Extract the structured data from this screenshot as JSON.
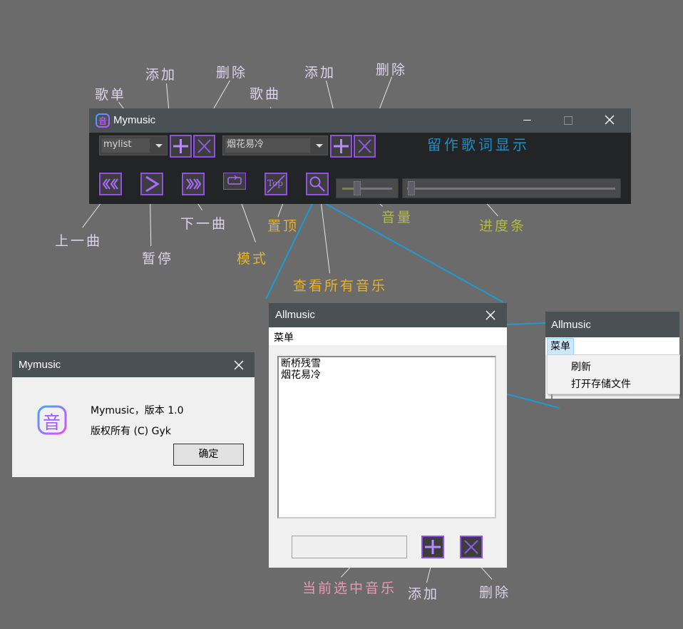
{
  "annotations": {
    "playlist": "歌单",
    "add_playlist": "添加",
    "delete_playlist": "删除",
    "song": "歌曲",
    "add_song": "添加",
    "delete_song": "删除",
    "prev": "上一曲",
    "pause": "暂停",
    "next": "下一曲",
    "mode": "模式",
    "pin_top": "置顶",
    "view_all": "查看所有音乐",
    "volume": "音量",
    "progress": "进度条",
    "lyrics": "留作歌词显示",
    "current_selected": "当前选中音乐",
    "add_bottom": "添加",
    "delete_bottom": "删除"
  },
  "main_window": {
    "title": "Mymusic",
    "app_icon_glyph": "音",
    "playlist_value": "mylist",
    "song_value": "烟花易冷",
    "pin_icon_text": "Top",
    "volume_level": 0.3,
    "progress_level": 0.02
  },
  "allmusic_window": {
    "title": "Allmusic",
    "menu_label": "菜单",
    "songs": [
      "断桥残雪",
      "烟花易冷"
    ],
    "selected_value": ""
  },
  "menu_popup": {
    "title": "Allmusic",
    "menu_label": "菜单",
    "items": [
      "刷新",
      "打开存储文件"
    ]
  },
  "about_dialog": {
    "title": "Mymusic",
    "icon_glyph": "音",
    "line1": "Mymusic，版本 1.0",
    "line2": "版权所有 (C) Gyk",
    "ok_label": "确定"
  },
  "colors": {
    "background": "#6b6b6b",
    "titlebar": "#4a5155",
    "accent_purple": "#8f52e0",
    "connector_blue": "#1c9bd6"
  }
}
